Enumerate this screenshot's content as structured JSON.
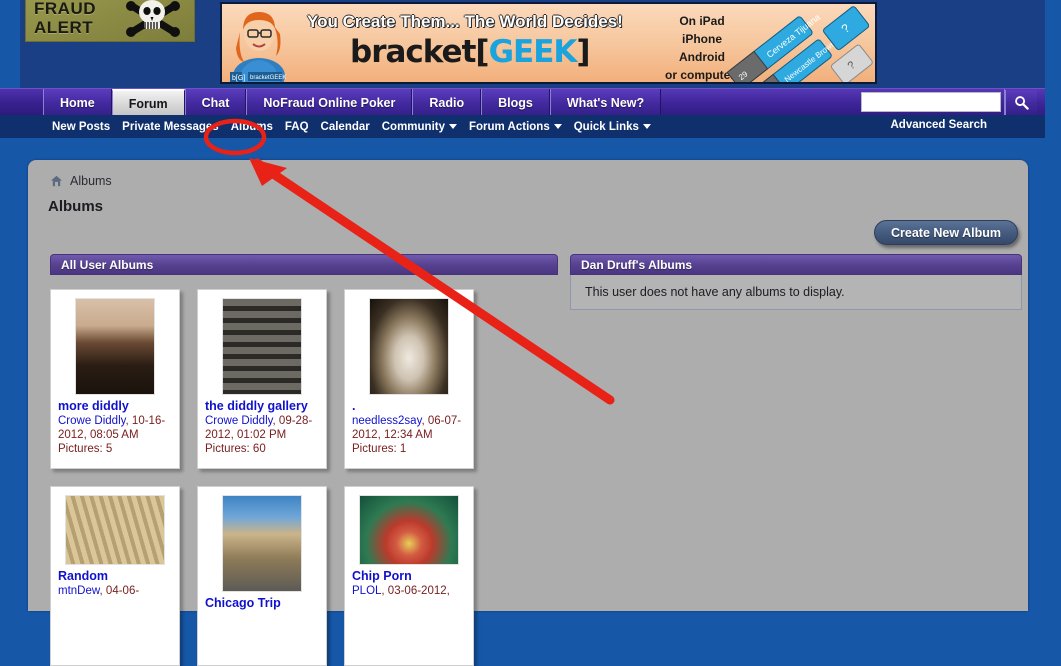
{
  "site": {
    "logo_line1": "FRAUD",
    "logo_line2": "ALERT",
    "logo_icon": "skull-and-crossbones-icon"
  },
  "ad": {
    "headline": "You Create Them... The World Decides!",
    "brand_prefix": "bracket[",
    "brand_highlight": "GEEK",
    "brand_suffix": "]",
    "platform_lines": "On iPad\niPhone\nAndroid\nor computer!",
    "platform_1": "On iPad",
    "platform_2": "iPhone",
    "platform_3": "Android",
    "platform_4": "or computer!",
    "chip_label_1": "Cerveza Tijuana",
    "chip_label_2": "Newcastle Brown Ale"
  },
  "nav": {
    "tabs": [
      {
        "label": "Home",
        "active": false
      },
      {
        "label": "Forum",
        "active": true
      },
      {
        "label": "Chat",
        "active": false
      },
      {
        "label": "NoFraud Online Poker",
        "active": false
      },
      {
        "label": "Radio",
        "active": false
      },
      {
        "label": "Blogs",
        "active": false
      },
      {
        "label": "What's New?",
        "active": false
      }
    ],
    "search_value": "",
    "search_placeholder": "",
    "search_icon": "search-icon"
  },
  "subnav": {
    "items": [
      {
        "label": "New Posts",
        "has_caret": false
      },
      {
        "label": "Private Messages",
        "has_caret": false
      },
      {
        "label": "Albums",
        "has_caret": false,
        "highlighted": true
      },
      {
        "label": "FAQ",
        "has_caret": false
      },
      {
        "label": "Calendar",
        "has_caret": false
      },
      {
        "label": "Community",
        "has_caret": true
      },
      {
        "label": "Forum Actions",
        "has_caret": true
      },
      {
        "label": "Quick Links",
        "has_caret": true
      }
    ],
    "advanced_search": "Advanced Search"
  },
  "content": {
    "breadcrumb": "Albums",
    "home_icon": "home-icon",
    "page_title": "Albums",
    "create_button": "Create New Album",
    "left_panel_header": "All User Albums",
    "right_panel_header": "Dan Druff's Albums",
    "right_panel_message": "This user does not have any albums to display."
  },
  "albums": [
    {
      "title": "more diddly",
      "user": "Crowe Diddly",
      "date": "10-16-2012, 08:05 AM",
      "pictures": "Pictures: 5",
      "thumb": "portrait-man-photo"
    },
    {
      "title": "the diddly gallery",
      "user": "Crowe Diddly",
      "date": "09-28-2012, 01:02 PM",
      "pictures": "Pictures: 60",
      "thumb": "brick-building-facade-photo"
    },
    {
      "title": ".",
      "user": "needless2say",
      "date": "06-07-2012, 12:34 AM",
      "pictures": "Pictures: 1",
      "thumb": "longhorn-steer-photo"
    },
    {
      "title": "Random",
      "user": "mtnDew",
      "date": "04-06-",
      "pictures": "",
      "thumb": "fanned-banknotes-photo"
    },
    {
      "title": "Chicago Trip",
      "user": "",
      "date": "",
      "pictures": "",
      "thumb": "theater-marquee-photo"
    },
    {
      "title": "Chip Porn",
      "user": "PLOL",
      "date": "03-06-2012,",
      "pictures": "",
      "thumb": "poker-chip-stacks-photo"
    }
  ],
  "annotation": {
    "ellipse_target": "Albums",
    "arrow_color": "#e82216",
    "ellipse_color": "#e82216"
  },
  "colors": {
    "page_background": "#1657a8",
    "nav_purple": "#42299e",
    "subnav_blue": "#102f6d",
    "content_gray": "#adadad",
    "panel_header_purple": "#584291",
    "link_blue": "#1111cc",
    "meta_red": "#7a2020"
  }
}
